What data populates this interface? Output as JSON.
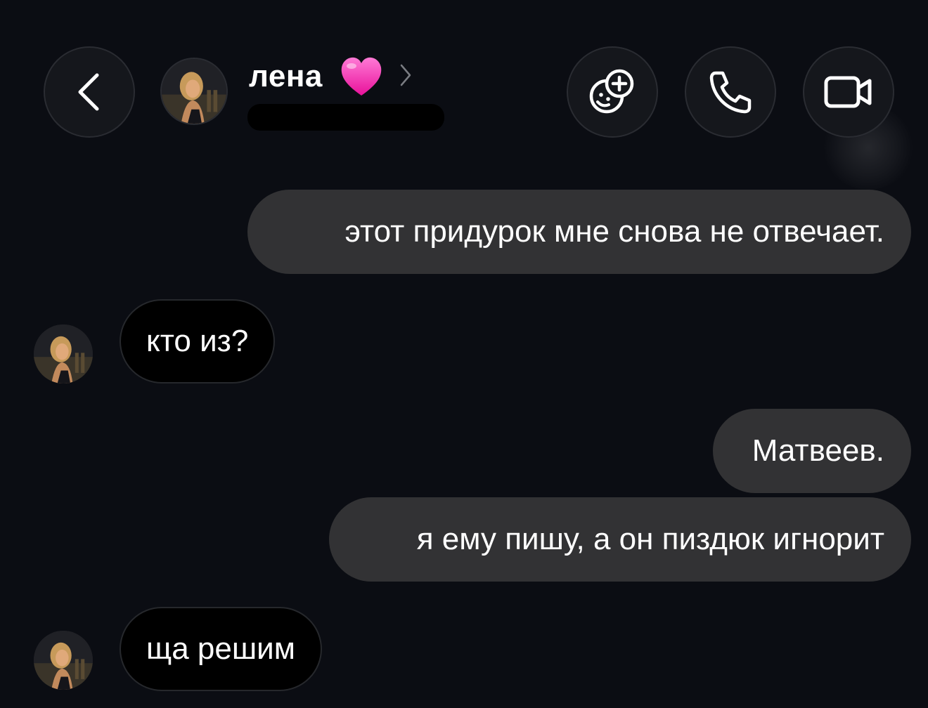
{
  "header": {
    "contact_name": "лена",
    "name_emoji_icon": "pink-heart-icon",
    "back_icon": "chevron-left-icon",
    "actions": [
      {
        "name": "add-sticker-button",
        "icon": "sticker-add-icon"
      },
      {
        "name": "voice-call-button",
        "icon": "phone-icon"
      },
      {
        "name": "video-call-button",
        "icon": "video-camera-icon"
      }
    ]
  },
  "messages": [
    {
      "direction": "outgoing",
      "text": "этот придурок мне снова не отвечает."
    },
    {
      "direction": "incoming",
      "text": "кто из?"
    },
    {
      "direction": "outgoing",
      "text": "Матвеев."
    },
    {
      "direction": "outgoing",
      "text": "я ему пишу, а он пиздюк игнорит"
    },
    {
      "direction": "incoming",
      "text": "ща решим"
    }
  ],
  "colors": {
    "background": "#0b0d13",
    "outgoing_bubble": "#323234",
    "incoming_bubble": "#000000",
    "heart": "#ff3dbb"
  }
}
